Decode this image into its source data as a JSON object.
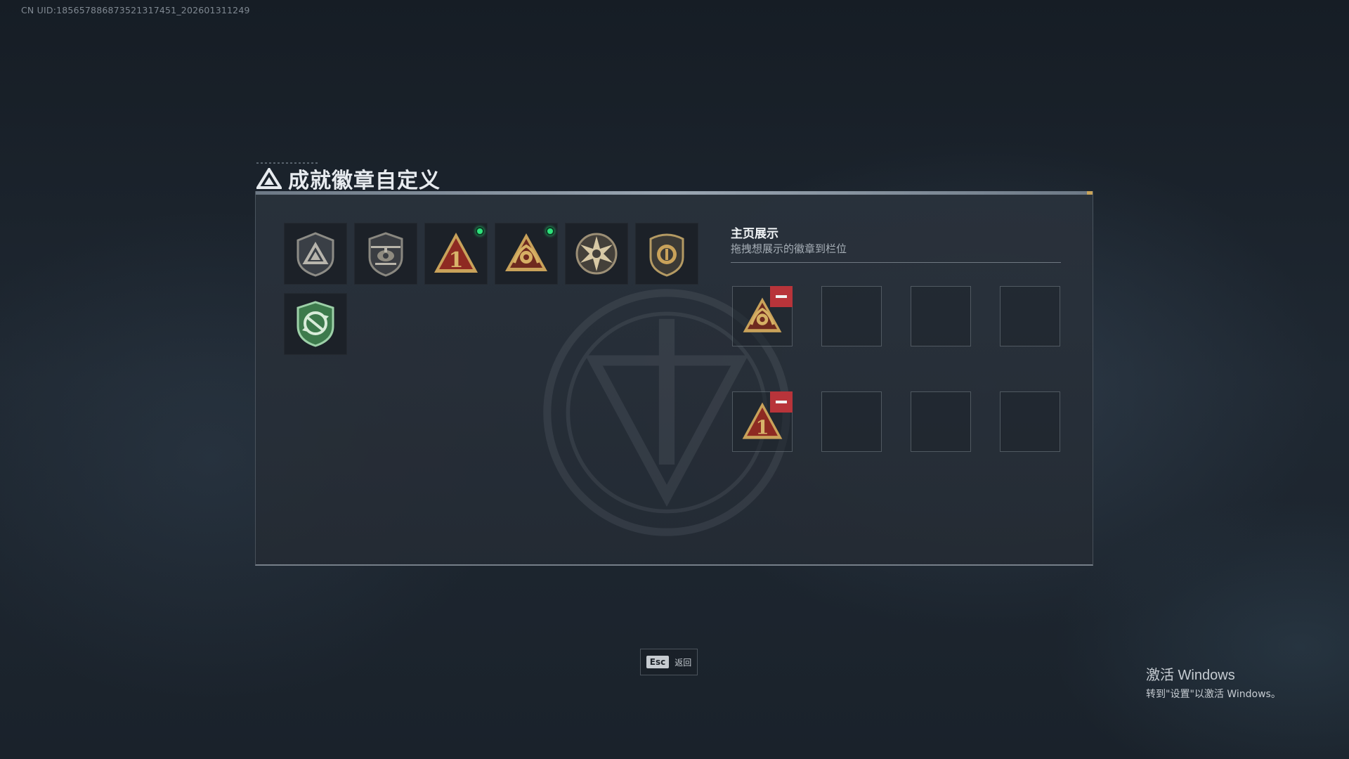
{
  "uid_text": "CN UID:185657886873521317451_202601311249",
  "title": "成就徽章自定义",
  "badges": [
    {
      "icon": "triangle-shield-badge-icon",
      "new": false
    },
    {
      "icon": "helicopter-badge-icon",
      "new": false
    },
    {
      "icon": "number-one-triangle-badge-icon",
      "new": true
    },
    {
      "icon": "laurel-triangle-badge-icon",
      "new": true
    },
    {
      "icon": "star-burst-badge-icon",
      "new": false
    },
    {
      "icon": "crest-shield-badge-icon",
      "new": false
    },
    {
      "icon": "green-recycle-shield-badge-icon",
      "new": false
    }
  ],
  "showcase": {
    "title": "主页展示",
    "subtitle": "拖拽想展示的徽章到栏位",
    "rows": [
      [
        "laurel-triangle-badge-icon",
        "",
        "",
        ""
      ],
      [
        "number-one-triangle-badge-icon",
        "",
        "",
        ""
      ]
    ]
  },
  "esc_button": {
    "key": "Esc",
    "label": "返回"
  },
  "windows_activation": {
    "line1": "激活 Windows",
    "line2": "转到\"设置\"以激活 Windows。"
  },
  "colors": {
    "new_dot": "#2ee27c",
    "remove_button": "#b8343a",
    "badge_gold": "#c9a25a",
    "badge_red": "#8e2a22",
    "badge_green": "#3d7a4c"
  }
}
